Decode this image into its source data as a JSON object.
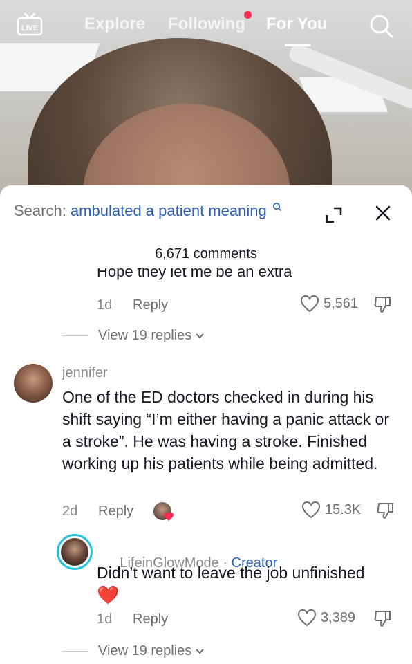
{
  "top_nav": {
    "live_label": "LIVE",
    "tabs": [
      {
        "label": "Explore",
        "active": false
      },
      {
        "label": "Following",
        "active": false
      },
      {
        "label": "For You",
        "active": true
      }
    ],
    "icons": [
      "live-icon",
      "search-icon"
    ]
  },
  "sheet": {
    "search_prefix": "Search: ",
    "search_query": "ambulated a patient meaning",
    "comments_count": "6,671 comments",
    "icons": [
      "expand-icon",
      "close-icon",
      "heart-icon",
      "thumbs-down-icon",
      "chevron-down-icon"
    ]
  },
  "comments": [
    {
      "text_partial": "Hope they let me be an extra",
      "time": "1d",
      "reply_label": "Reply",
      "likes": "5,561",
      "view_replies": "View 19 replies"
    },
    {
      "username": "jennifer",
      "text": "One of the ED doctors checked in during his shift saying “I’m either having a panic attack or a stroke”. He was having a stroke. Finished working up his patients while being admitted.",
      "time": "2d",
      "reply_label": "Reply",
      "likes": "15.3K",
      "creator_liked": true
    },
    {
      "username": "LifeinGlowMode",
      "separator": " · ",
      "badge": "Creator",
      "text": "Didn’t want to leave the job unfinished",
      "emoji": "❤️",
      "time": "1d",
      "reply_label": "Reply",
      "likes": "3,389",
      "view_replies": "View 19 replies"
    }
  ],
  "colors": {
    "accent_link": "#2c5fb3",
    "notification_dot": "#fe2c55",
    "creator_ring": "#25c3e0"
  }
}
